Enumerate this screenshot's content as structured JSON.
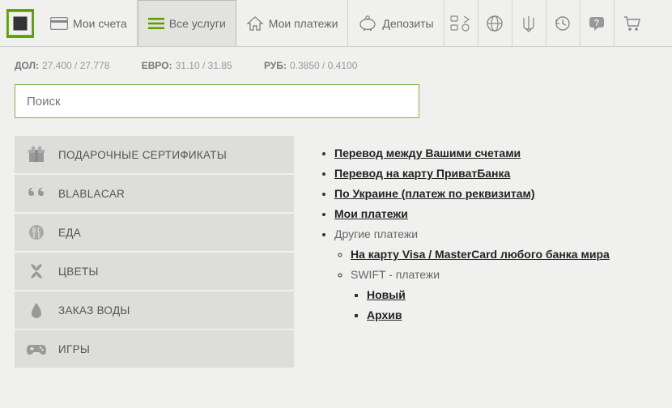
{
  "nav": {
    "accounts": "Мои счета",
    "services": "Все услуги",
    "payments": "Мои платежи",
    "deposits": "Депозиты"
  },
  "rates": {
    "usd_label": "ДОЛ:",
    "usd": "27.400 / 27.778",
    "eur_label": "ЕВРО:",
    "eur": "31.10 / 31.85",
    "rub_label": "РУБ:",
    "rub": "0.3850 / 0.4100"
  },
  "search": {
    "placeholder": "Поиск"
  },
  "categories": [
    {
      "label": "ПОДАРОЧНЫЕ СЕРТИФИКАТЫ",
      "icon": "gift"
    },
    {
      "label": "BLABLACAR",
      "icon": "quotes"
    },
    {
      "label": "ЕДА",
      "icon": "food"
    },
    {
      "label": "ЦВЕТЫ",
      "icon": "flower"
    },
    {
      "label": "ЗАКАЗ ВОДЫ",
      "icon": "water"
    },
    {
      "label": "ИГРЫ",
      "icon": "games"
    }
  ],
  "tree": {
    "l1": "Перевод между Вашими счетами",
    "l2": "Перевод на карту ПриватБанка",
    "l3": "По Украине (платеж по реквизитам)",
    "l4": "Мои платежи",
    "l5": "Другие платежи",
    "l6": "На карту Visa / MasterCard любого банка мира",
    "l7": "SWIFT - платежи",
    "l8": "Новый",
    "l9": "Архив"
  }
}
